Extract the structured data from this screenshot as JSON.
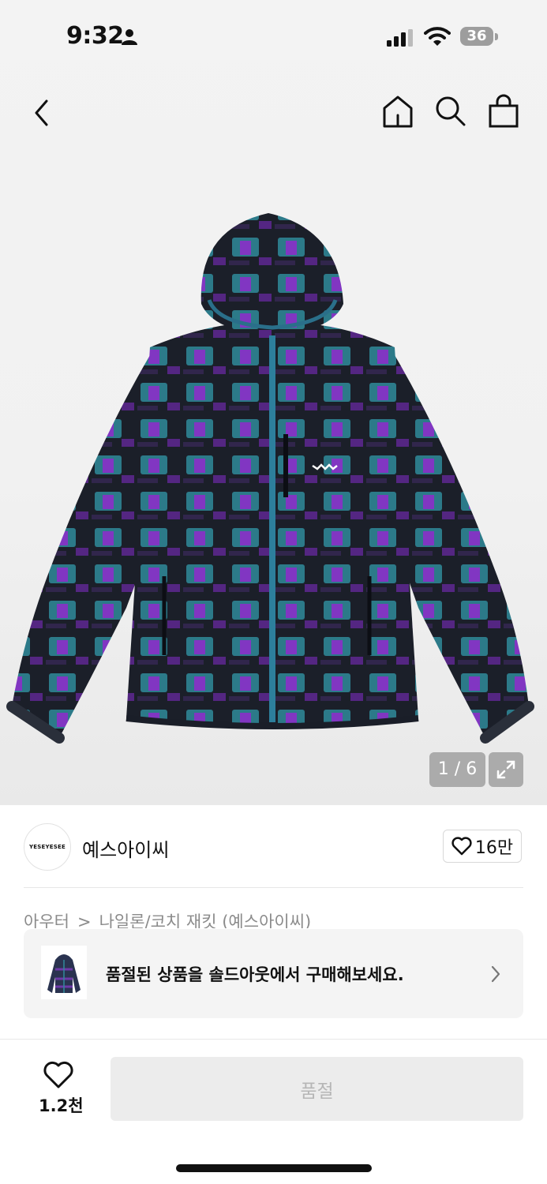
{
  "status_bar": {
    "time": "9:32",
    "battery": "36"
  },
  "gallery": {
    "counter": "1 / 6"
  },
  "brand": {
    "logo_text": "YESEYESEE",
    "name": "예스아이씨",
    "like_count": "16만"
  },
  "breadcrumb": {
    "category": "아우터",
    "separator": ">",
    "subcategory": "나일론/코치 재킷 (예스아이씨)"
  },
  "soldout_banner": {
    "text": "품절된 상품을 솔드아웃에서 구매해보세요."
  },
  "bottom_bar": {
    "wish_count": "1.2천",
    "buy_label": "품절"
  },
  "colors": {
    "jacket_base": "#1a1f2b",
    "jacket_teal": "#2f8a9a",
    "jacket_purple": "#8b2fc9",
    "soldout_button": "#ececec"
  },
  "icons": [
    "person-icon",
    "signal-icon",
    "wifi-icon",
    "back-arrow-icon",
    "home-icon",
    "search-icon",
    "bag-icon",
    "expand-icon",
    "heart-icon",
    "chevron-right-icon"
  ]
}
